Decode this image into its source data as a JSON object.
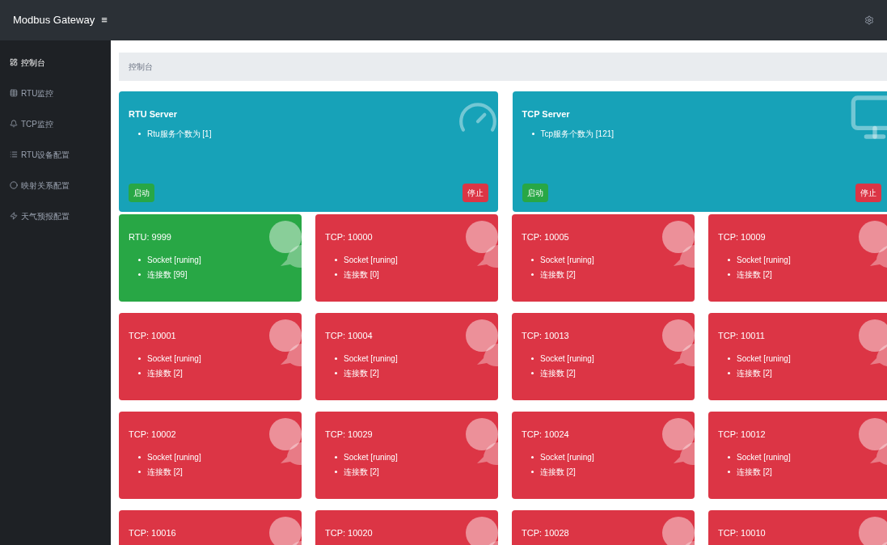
{
  "topbar": {
    "brand": "Modbus Gateway",
    "menu_glyph": "≡"
  },
  "sidebar": {
    "items": [
      {
        "label": "控制台",
        "selected": true
      },
      {
        "label": "RTU监控",
        "selected": false
      },
      {
        "label": "TCP监控",
        "selected": false
      },
      {
        "label": "RTU设备配置",
        "selected": false
      },
      {
        "label": "映射关系配置",
        "selected": false
      },
      {
        "label": "天气预报配置",
        "selected": false
      }
    ]
  },
  "breadcrumb": "控制台",
  "servers": [
    {
      "title": "RTU Server",
      "line": "Rtu服务个数为 [1]",
      "start": "启动",
      "stop": "停止"
    },
    {
      "title": "TCP Server",
      "line": "Tcp服务个数为 [121]",
      "start": "启动",
      "stop": "停止"
    }
  ],
  "ports": [
    {
      "title": "RTU: 9999",
      "color": "#28a745",
      "lines": [
        "Socket [runing]",
        "连接数 [99]"
      ]
    },
    {
      "title": "TCP: 10000",
      "color": "#dc3545",
      "lines": [
        "Socket [runing]",
        "连接数 [0]"
      ]
    },
    {
      "title": "TCP: 10005",
      "color": "#dc3545",
      "lines": [
        "Socket [runing]",
        "连接数 [2]"
      ]
    },
    {
      "title": "TCP: 10009",
      "color": "#dc3545",
      "lines": [
        "Socket [runing]",
        "连接数 [2]"
      ]
    },
    {
      "title": "TCP: 10001",
      "color": "#dc3545",
      "lines": [
        "Socket [runing]",
        "连接数 [2]"
      ]
    },
    {
      "title": "TCP: 10004",
      "color": "#dc3545",
      "lines": [
        "Socket [runing]",
        "连接数 [2]"
      ]
    },
    {
      "title": "TCP: 10013",
      "color": "#dc3545",
      "lines": [
        "Socket [runing]",
        "连接数 [2]"
      ]
    },
    {
      "title": "TCP: 10011",
      "color": "#dc3545",
      "lines": [
        "Socket [runing]",
        "连接数 [2]"
      ]
    },
    {
      "title": "TCP: 10002",
      "color": "#dc3545",
      "lines": [
        "Socket [runing]",
        "连接数 [2]"
      ]
    },
    {
      "title": "TCP: 10029",
      "color": "#dc3545",
      "lines": [
        "Socket [runing]",
        "连接数 [2]"
      ]
    },
    {
      "title": "TCP: 10024",
      "color": "#dc3545",
      "lines": [
        "Socket [runing]",
        "连接数 [2]"
      ]
    },
    {
      "title": "TCP: 10012",
      "color": "#dc3545",
      "lines": [
        "Socket [runing]",
        "连接数 [2]"
      ]
    },
    {
      "title": "TCP: 10016",
      "color": "#dc3545"
    },
    {
      "title": "TCP: 10020",
      "color": "#dc3545"
    },
    {
      "title": "TCP: 10028",
      "color": "#dc3545"
    },
    {
      "title": "TCP: 10010",
      "color": "#dc3545"
    }
  ]
}
